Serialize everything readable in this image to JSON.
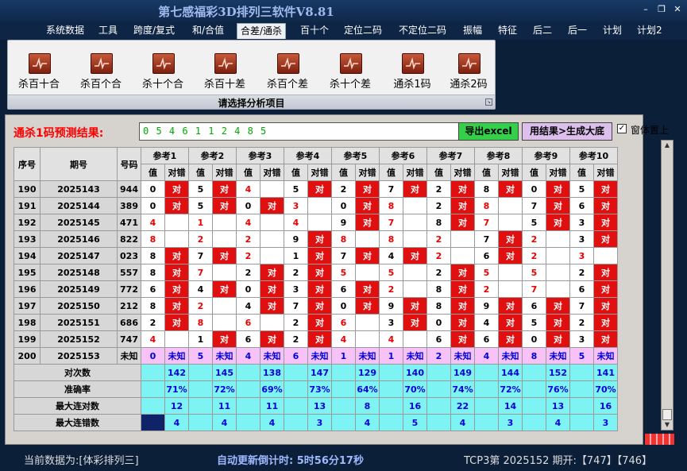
{
  "app": {
    "title": "第七感福彩3D排列三软件V8.81"
  },
  "window": {
    "minimize": "–",
    "restore": "❐",
    "close": "✕"
  },
  "menu": [
    "系统数据",
    "工具",
    "跨度/复式",
    "和/合值",
    "合差/通杀",
    "百十个",
    "定位二码",
    "不定位二码",
    "振幅",
    "特征",
    "后二",
    "后一",
    "计划",
    "计划2"
  ],
  "ribbon": {
    "buttons": [
      "杀百十合",
      "杀百个合",
      "杀十个合",
      "杀百十差",
      "杀百个差",
      "杀十个差",
      "通杀1码",
      "通杀2码"
    ],
    "caption": "请选择分析项目",
    "button_icon": "chart-icon"
  },
  "prediction": {
    "label": "通杀1码预测结果:",
    "value": "0 5 4 6 1 1 2 4 8 5"
  },
  "buttons": {
    "export": "导出excel",
    "generate": "用结果>生成大底",
    "ontop_label": "窗体置上",
    "ontop_check": "✓"
  },
  "colors": {
    "hit": "#e01010",
    "pred_row": "#f7c2f7",
    "stat_row": "#7ef3f3",
    "export": "#35d04a",
    "generate": "#ddbfee"
  },
  "table": {
    "headers": {
      "seq": "序号",
      "period": "期号",
      "number": "号码",
      "ref_prefix": "参考",
      "value": "值",
      "hit": "对错"
    },
    "refs": [
      "参考1",
      "参考2",
      "参考3",
      "参考4",
      "参考5",
      "参考6",
      "参考7",
      "参考8",
      "参考9",
      "参考10"
    ],
    "hit_text": "对",
    "rows": [
      {
        "seq": "190",
        "period": "2025143",
        "number": "944",
        "cells": [
          [
            "0",
            1,
            0
          ],
          [
            "5",
            1,
            0
          ],
          [
            "4",
            0,
            1
          ],
          [
            "5",
            1,
            0
          ],
          [
            "2",
            1,
            0
          ],
          [
            "7",
            1,
            0
          ],
          [
            "2",
            1,
            0
          ],
          [
            "8",
            1,
            0
          ],
          [
            "0",
            1,
            0
          ],
          [
            "5",
            1,
            0
          ]
        ]
      },
      {
        "seq": "191",
        "period": "2025144",
        "number": "389",
        "cells": [
          [
            "0",
            1,
            0
          ],
          [
            "5",
            1,
            0
          ],
          [
            "0",
            1,
            0
          ],
          [
            "3",
            0,
            1
          ],
          [
            "0",
            1,
            0
          ],
          [
            "8",
            0,
            1
          ],
          [
            "2",
            1,
            0
          ],
          [
            "8",
            0,
            1
          ],
          [
            "7",
            1,
            0
          ],
          [
            "6",
            1,
            0
          ]
        ]
      },
      {
        "seq": "192",
        "period": "2025145",
        "number": "471",
        "cells": [
          [
            "4",
            0,
            1
          ],
          [
            "1",
            0,
            1
          ],
          [
            "4",
            0,
            1
          ],
          [
            "4",
            0,
            1
          ],
          [
            "9",
            1,
            0
          ],
          [
            "7",
            0,
            1
          ],
          [
            "8",
            1,
            0
          ],
          [
            "7",
            0,
            1
          ],
          [
            "5",
            1,
            0
          ],
          [
            "3",
            1,
            0
          ]
        ]
      },
      {
        "seq": "193",
        "period": "2025146",
        "number": "822",
        "cells": [
          [
            "8",
            0,
            1
          ],
          [
            "2",
            0,
            1
          ],
          [
            "2",
            0,
            1
          ],
          [
            "9",
            1,
            0
          ],
          [
            "8",
            0,
            1
          ],
          [
            "8",
            0,
            1
          ],
          [
            "2",
            0,
            1
          ],
          [
            "7",
            1,
            0
          ],
          [
            "2",
            0,
            1
          ],
          [
            "3",
            1,
            0
          ]
        ]
      },
      {
        "seq": "194",
        "period": "2025147",
        "number": "023",
        "cells": [
          [
            "8",
            1,
            0
          ],
          [
            "7",
            1,
            0
          ],
          [
            "2",
            0,
            1
          ],
          [
            "1",
            1,
            0
          ],
          [
            "7",
            1,
            0
          ],
          [
            "4",
            1,
            0
          ],
          [
            "2",
            0,
            1
          ],
          [
            "6",
            1,
            0
          ],
          [
            "2",
            0,
            1
          ],
          [
            "3",
            0,
            1
          ]
        ]
      },
      {
        "seq": "195",
        "period": "2025148",
        "number": "557",
        "cells": [
          [
            "8",
            1,
            0
          ],
          [
            "7",
            0,
            1
          ],
          [
            "2",
            1,
            0
          ],
          [
            "2",
            1,
            0
          ],
          [
            "5",
            0,
            1
          ],
          [
            "5",
            0,
            1
          ],
          [
            "2",
            1,
            0
          ],
          [
            "5",
            0,
            1
          ],
          [
            "5",
            0,
            1
          ],
          [
            "2",
            1,
            0
          ]
        ]
      },
      {
        "seq": "196",
        "period": "2025149",
        "number": "772",
        "cells": [
          [
            "6",
            1,
            0
          ],
          [
            "4",
            1,
            0
          ],
          [
            "0",
            1,
            0
          ],
          [
            "3",
            1,
            0
          ],
          [
            "6",
            1,
            0
          ],
          [
            "2",
            0,
            1
          ],
          [
            "8",
            1,
            0
          ],
          [
            "2",
            0,
            1
          ],
          [
            "7",
            0,
            1
          ],
          [
            "6",
            1,
            0
          ]
        ]
      },
      {
        "seq": "197",
        "period": "2025150",
        "number": "212",
        "cells": [
          [
            "8",
            1,
            0
          ],
          [
            "2",
            0,
            1
          ],
          [
            "4",
            1,
            0
          ],
          [
            "7",
            1,
            0
          ],
          [
            "0",
            1,
            0
          ],
          [
            "9",
            1,
            0
          ],
          [
            "8",
            1,
            0
          ],
          [
            "9",
            1,
            0
          ],
          [
            "6",
            1,
            0
          ],
          [
            "7",
            1,
            0
          ]
        ]
      },
      {
        "seq": "198",
        "period": "2025151",
        "number": "686",
        "cells": [
          [
            "2",
            1,
            0
          ],
          [
            "8",
            0,
            1
          ],
          [
            "6",
            0,
            1
          ],
          [
            "2",
            1,
            0
          ],
          [
            "6",
            0,
            1
          ],
          [
            "3",
            1,
            0
          ],
          [
            "0",
            1,
            0
          ],
          [
            "4",
            1,
            0
          ],
          [
            "5",
            1,
            0
          ],
          [
            "2",
            1,
            0
          ]
        ]
      },
      {
        "seq": "199",
        "period": "2025152",
        "number": "747",
        "cells": [
          [
            "4",
            0,
            1
          ],
          [
            "1",
            1,
            0
          ],
          [
            "6",
            1,
            0
          ],
          [
            "2",
            1,
            0
          ],
          [
            "4",
            0,
            1
          ],
          [
            "4",
            0,
            1
          ],
          [
            "6",
            1,
            0
          ],
          [
            "6",
            1,
            0
          ],
          [
            "0",
            1,
            0
          ],
          [
            "3",
            1,
            0
          ]
        ]
      }
    ],
    "pred_row": {
      "seq": "200",
      "period": "2025153",
      "number": "未知",
      "values": [
        "0",
        "5",
        "4",
        "6",
        "1",
        "1",
        "2",
        "4",
        "8",
        "5"
      ],
      "status": "未知"
    },
    "stats": [
      {
        "label": "对次数",
        "values": [
          "142",
          "145",
          "138",
          "147",
          "129",
          "140",
          "149",
          "144",
          "152",
          "141"
        ]
      },
      {
        "label": "准确率",
        "values": [
          "71%",
          "72%",
          "69%",
          "73%",
          "64%",
          "70%",
          "74%",
          "72%",
          "76%",
          "70%"
        ]
      },
      {
        "label": "最大连对数",
        "values": [
          "12",
          "11",
          "11",
          "13",
          "8",
          "16",
          "22",
          "14",
          "13",
          "16"
        ]
      },
      {
        "label": "最大连错数",
        "values": [
          "4",
          "4",
          "4",
          "3",
          "4",
          "5",
          "4",
          "3",
          "4",
          "3"
        ]
      }
    ]
  },
  "status": {
    "data_source": "当前数据为:[体彩排列三]",
    "countdown_label": "自动更新倒计时:",
    "countdown_value": "5时56分17秒",
    "draw": "TCP3第 2025152 期开:【747】【746】"
  }
}
